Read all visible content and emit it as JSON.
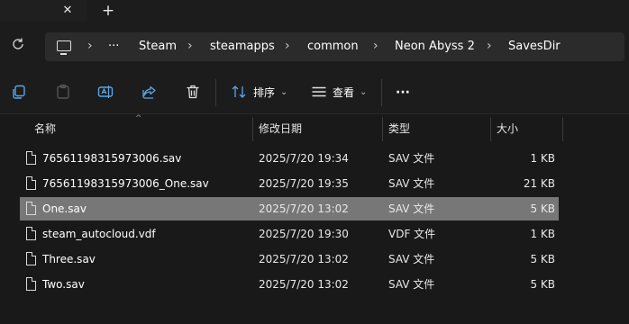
{
  "window": {
    "close_tab_glyph": "✕",
    "new_tab_glyph": "+"
  },
  "address": {
    "more": "···",
    "crumbs": [
      "Steam",
      "steamapps",
      "common",
      "Neon Abyss 2",
      "SavesDir"
    ]
  },
  "toolbar": {
    "sort_label": "排序",
    "view_label": "查看",
    "more_glyph": "···"
  },
  "columns": {
    "name": "名称",
    "date": "修改日期",
    "type": "类型",
    "size": "大小"
  },
  "files": [
    {
      "name": "76561198315973006.sav",
      "date": "2025/7/20 19:34",
      "type": "SAV 文件",
      "size": "1 KB",
      "selected": false
    },
    {
      "name": "76561198315973006_One.sav",
      "date": "2025/7/20 19:35",
      "type": "SAV 文件",
      "size": "21 KB",
      "selected": false
    },
    {
      "name": "One.sav",
      "date": "2025/7/20 13:02",
      "type": "SAV 文件",
      "size": "5 KB",
      "selected": true
    },
    {
      "name": "steam_autocloud.vdf",
      "date": "2025/7/20 19:30",
      "type": "VDF 文件",
      "size": "1 KB",
      "selected": false
    },
    {
      "name": "Three.sav",
      "date": "2025/7/20 13:02",
      "type": "SAV 文件",
      "size": "5 KB",
      "selected": false
    },
    {
      "name": "Two.sav",
      "date": "2025/7/20 13:02",
      "type": "SAV 文件",
      "size": "5 KB",
      "selected": false
    }
  ],
  "colors": {
    "background": "#191919",
    "selection": "#777777",
    "address_bar": "#2b2b2b"
  }
}
